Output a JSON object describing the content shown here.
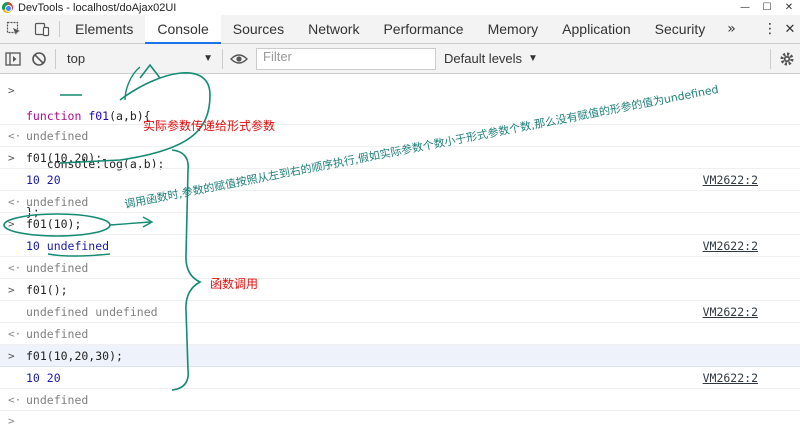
{
  "window": {
    "title": "DevTools - localhost/doAjax02UI",
    "minimize": "—",
    "maximize": "☐",
    "close": "✕"
  },
  "tabs": [
    {
      "label": "Elements"
    },
    {
      "label": "Console"
    },
    {
      "label": "Sources"
    },
    {
      "label": "Network"
    },
    {
      "label": "Performance"
    },
    {
      "label": "Memory"
    },
    {
      "label": "Application"
    },
    {
      "label": "Security"
    }
  ],
  "tabs_more": "»",
  "toolbar": {
    "context": "top",
    "filter_placeholder": "Filter",
    "levels": "Default levels",
    "dropdown_arrow": "▼"
  },
  "console": {
    "rows": [
      {
        "type": "input",
        "gutter": ">",
        "lines": [
          "function f01(a,b){",
          "   console.log(a,b);",
          "};"
        ]
      },
      {
        "type": "return",
        "gutter": "<·",
        "text": "undefined"
      },
      {
        "type": "input",
        "gutter": ">",
        "text": "f01(10,20);"
      },
      {
        "type": "log",
        "text": "10 20",
        "source": "VM2622:2"
      },
      {
        "type": "return",
        "gutter": "<·",
        "text": "undefined"
      },
      {
        "type": "input",
        "gutter": ">",
        "text": "f01(10);"
      },
      {
        "type": "log",
        "text": "10 undefined",
        "source": "VM2622:2"
      },
      {
        "type": "return",
        "gutter": "<·",
        "text": "undefined"
      },
      {
        "type": "input",
        "gutter": ">",
        "text": "f01();"
      },
      {
        "type": "log",
        "text": "undefined undefined",
        "source": "VM2622:2"
      },
      {
        "type": "return",
        "gutter": "<·",
        "text": "undefined"
      },
      {
        "type": "input",
        "gutter": ">",
        "text": "f01(10,20,30);"
      },
      {
        "type": "log",
        "text": "10 20",
        "source": "VM2622:2"
      },
      {
        "type": "return",
        "gutter": "<·",
        "text": "undefined"
      }
    ],
    "prompt": ">"
  },
  "annotations": {
    "params": "实际参数传递给形式参数",
    "order": "调用函数时,参数的赋值按照从左到右的顺序执行,假如实际参数个数小于形式参数个数,那么没有赋值的形参的值为undefined",
    "call": "函数调用"
  },
  "colors": {
    "accent": "#1a73e8",
    "annot_red": "#e01010",
    "annot_teal": "#1f7f7a",
    "pen_green": "#138a72"
  }
}
